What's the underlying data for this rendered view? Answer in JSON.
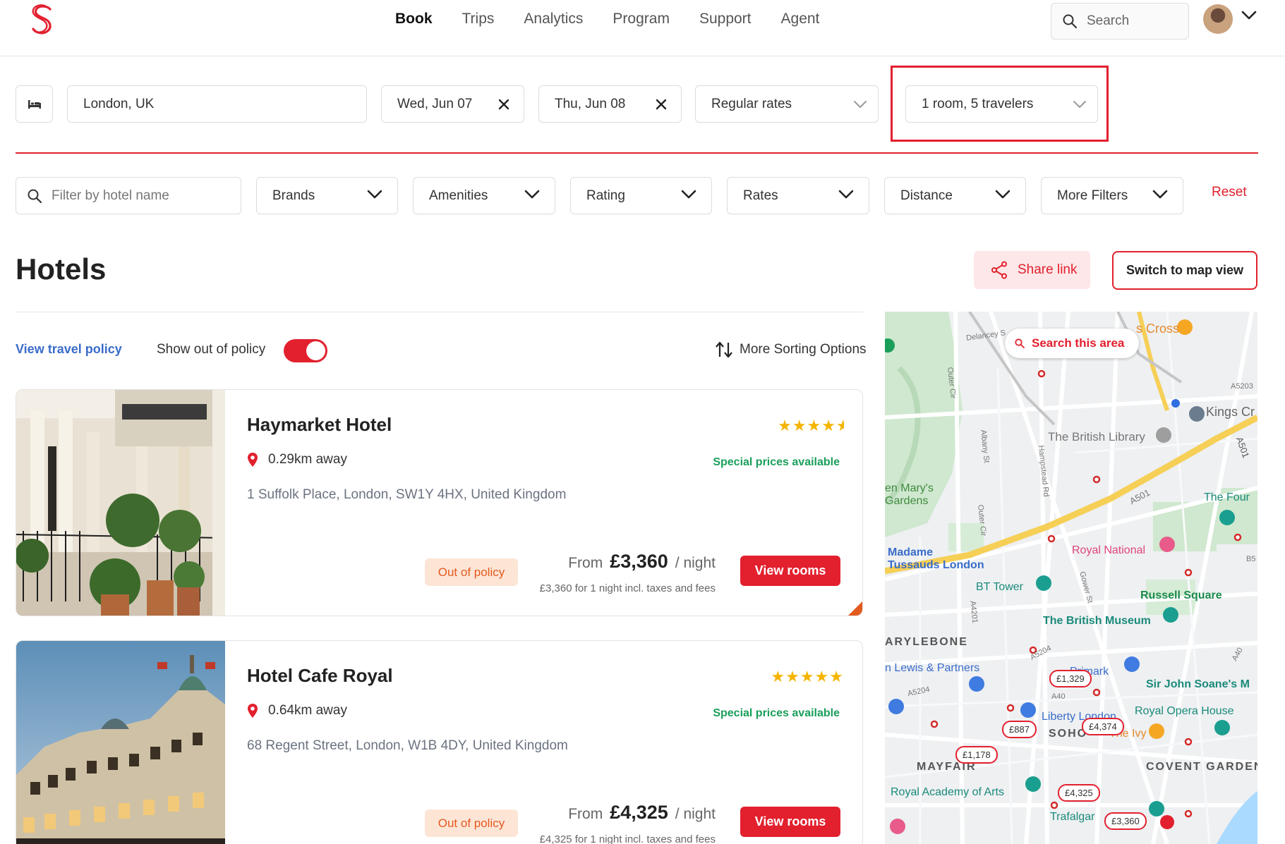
{
  "nav": {
    "items": [
      "Book",
      "Trips",
      "Analytics",
      "Program",
      "Support",
      "Agent"
    ],
    "active": "Book",
    "search_label": "Search"
  },
  "search": {
    "destination": "London, UK",
    "checkin": "Wed, Jun 07",
    "checkout": "Thu, Jun 08",
    "rate_type": "Regular rates",
    "rooms_travelers": "1 room, 5 travelers"
  },
  "filters": {
    "hotel_name_placeholder": "Filter by hotel name",
    "brands": "Brands",
    "amenities": "Amenities",
    "rating": "Rating",
    "rates": "Rates",
    "distance": "Distance",
    "more_filters": "More Filters",
    "reset": "Reset"
  },
  "header": {
    "title": "Hotels",
    "share_link": "Share link",
    "switch_map": "Switch to map view"
  },
  "policy": {
    "view_travel_policy": "View travel policy",
    "show_out_of_policy": "Show out of policy",
    "toggle_on": true,
    "sorting": "More Sorting Options"
  },
  "hotels": [
    {
      "name": "Haymarket Hotel",
      "stars": "★★★★",
      "half_star": true,
      "distance": "0.29km away",
      "special": "Special prices available",
      "address": "1 Suffolk Place, London, SW1Y 4HX, United Kingdom",
      "policy_badge": "Out of policy",
      "from": "From",
      "price": "£3,360",
      "per": "/ night",
      "total": "£3,360 for 1 night incl. taxes and fees",
      "cta": "View rooms"
    },
    {
      "name": "Hotel Cafe Royal",
      "stars": "★★★★★",
      "half_star": false,
      "distance": "0.64km away",
      "special": "Special prices available",
      "address": "68 Regent Street, London, W1B 4DY, United Kingdom",
      "policy_badge": "Out of policy",
      "from": "From",
      "price": "£4,325",
      "per": "/ night",
      "total": "£4,325 for 1 night incl. taxes and fees",
      "cta": "View rooms"
    }
  ],
  "map": {
    "search_area": "Search this area",
    "labels": {
      "kings_cross": "s Cross",
      "delancey": "Delancey S",
      "kings_cr": "Kings Cr",
      "british_library": "The British Library",
      "a5203": "A5203",
      "a501": "A501",
      "a501b": "A501",
      "outer_cir": "Outer Cir",
      "outer_cir2": "Outer Cir",
      "albany": "Albany St",
      "hampstead": "Hampstead Rd",
      "marys_gardens": "en Mary's\nGardens",
      "the_four": "The Four",
      "madame_tussauds": "Madame\nTussauds London",
      "royal_national": "Royal National",
      "bt_tower": "BT Tower",
      "russell_square": "Russell Square",
      "british_museum": "The British Museum",
      "marylebone": "ARYLEBONE",
      "a4201": "A4201",
      "a5204": "A5204",
      "a5204b": "A5204",
      "a40": "A40",
      "a40b": "A40",
      "john_lewis": "n Lewis & Partners",
      "primark": "Primark",
      "john_soane": "Sir John Soane's M",
      "liberty": "Liberty London",
      "royal_opera": "Royal Opera House",
      "soho": "SOHO",
      "the_ivy": "The Ivy",
      "mayfair": "MAYFAIR",
      "covent_garden": "COVENT GARDEN",
      "royal_academy": "Royal Academy of Arts",
      "trafalgar": "Trafalgar",
      "gower": "Gower St",
      "b5": "B5"
    },
    "price_pins": [
      "£1,329",
      "£887",
      "£4,374",
      "£1,178",
      "£4,325",
      "£3,360"
    ]
  },
  "colors": {
    "brand_red": "#e2202e",
    "success_green": "#1a9e5a",
    "policy_orange": "#e35a1f",
    "link_blue": "#3a6cc9"
  }
}
